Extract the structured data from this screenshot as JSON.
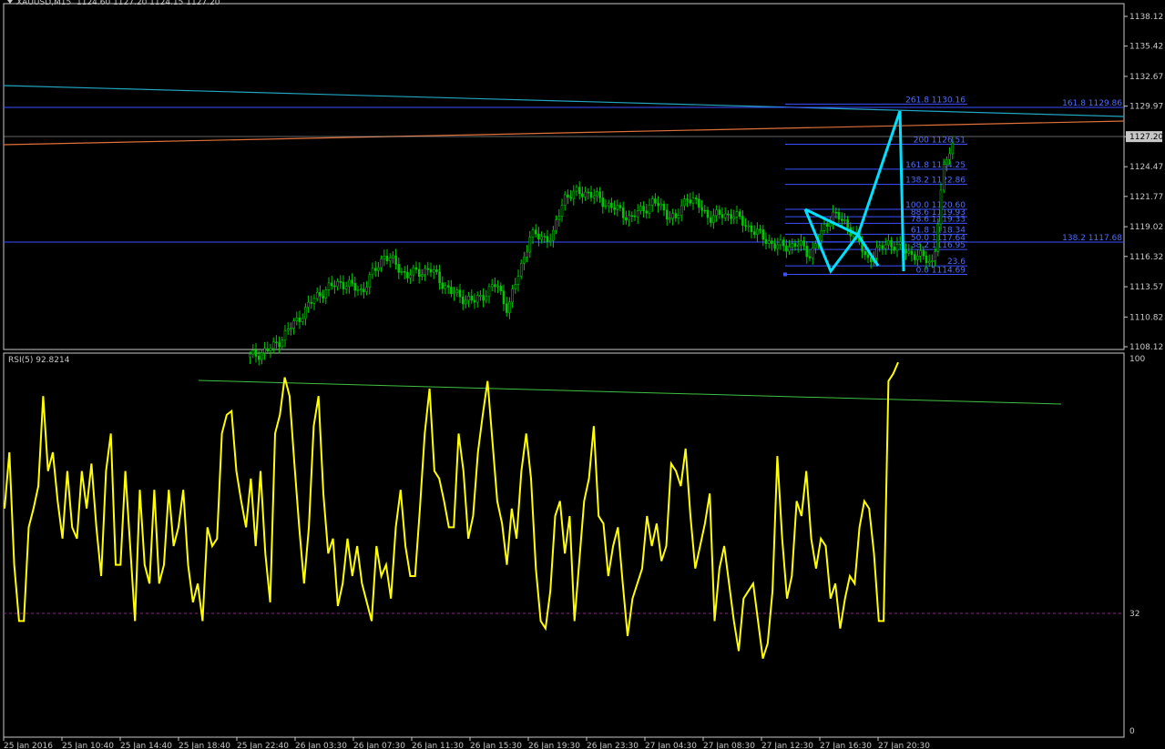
{
  "header": {
    "symbol": "XAUUSD,M15",
    "ohlc": "1124.60 1127.20 1124.15 1127.20",
    "rsi_label": "RSI(5) 92.8214"
  },
  "colors": {
    "background": "#000000",
    "candle_up": "#00c800",
    "rsi_line": "#ffff00",
    "fib_line": "#3c50ff",
    "fib_text": "#4f6cff",
    "zigzag": "#00e0ff",
    "trend_cyan": "#22a4c2",
    "trend_orange": "#e0703a",
    "trend_green": "#40c040",
    "axis": "#c8c8c8",
    "rsi_level": "#7a2a7a"
  },
  "chart_data": [
    {
      "type": "candlestick",
      "symbol": "XAUUSD",
      "timeframe": "M15",
      "ylim": [
        1108.12,
        1138.12
      ],
      "price_ticks": [
        "1138.12",
        "1135.42",
        "1132.67",
        "1129.97",
        "1127.20",
        "1124.47",
        "1121.77",
        "1119.02",
        "1116.32",
        "1113.57",
        "1110.82",
        "1108.12"
      ],
      "current_price": "1127.20",
      "time_ticks": [
        "25 Jan 2016",
        "25 Jan 10:40",
        "25 Jan 14:40",
        "25 Jan 18:40",
        "25 Jan 22:40",
        "26 Jan 03:30",
        "26 Jan 07:30",
        "26 Jan 11:30",
        "26 Jan 15:30",
        "26 Jan 19:30",
        "26 Jan 23:30",
        "27 Jan 04:30",
        "27 Jan 08:30",
        "27 Jan 12:30",
        "27 Jan 16:30",
        "27 Jan 20:30"
      ],
      "close_path": [
        [
          0.22,
          1107.2
        ],
        [
          0.24,
          1108.0
        ],
        [
          0.26,
          1110.3
        ],
        [
          0.28,
          1112.8
        ],
        [
          0.3,
          1114.0
        ],
        [
          0.32,
          1113.2
        ],
        [
          0.34,
          1116.5
        ],
        [
          0.36,
          1114.6
        ],
        [
          0.38,
          1115.2
        ],
        [
          0.4,
          1113.0
        ],
        [
          0.42,
          1112.2
        ],
        [
          0.44,
          1113.8
        ],
        [
          0.45,
          1111.5
        ],
        [
          0.47,
          1118.2
        ],
        [
          0.49,
          1118.0
        ],
        [
          0.5,
          1121.8
        ],
        [
          0.52,
          1122.2
        ],
        [
          0.54,
          1121.0
        ],
        [
          0.56,
          1119.8
        ],
        [
          0.58,
          1121.3
        ],
        [
          0.6,
          1119.6
        ],
        [
          0.61,
          1121.9
        ],
        [
          0.63,
          1119.9
        ],
        [
          0.65,
          1120.2
        ],
        [
          0.67,
          1118.6
        ],
        [
          0.69,
          1117.2
        ],
        [
          0.71,
          1117.4
        ],
        [
          0.72,
          1116.5
        ],
        [
          0.74,
          1120.3
        ],
        [
          0.76,
          1118.4
        ],
        [
          0.77,
          1116.0
        ],
        [
          0.79,
          1117.6
        ],
        [
          0.81,
          1116.6
        ],
        [
          0.83,
          1115.8
        ],
        [
          0.84,
          1125.0
        ],
        [
          0.85,
          1127.2
        ]
      ],
      "fib_upper": [
        {
          "level": "261.8",
          "price": "1130.16"
        },
        {
          "level": "200",
          "price": "1126.51"
        },
        {
          "level": "161.8",
          "price": "1124.25"
        },
        {
          "level": "138.2",
          "price": "1122.86"
        },
        {
          "level": "100.0",
          "price": "1120.60"
        },
        {
          "level": "88.6",
          "price": "1119.93"
        },
        {
          "level": "78.6",
          "price": "1119.33"
        },
        {
          "level": "61.8",
          "price": "1118.34"
        },
        {
          "level": "50.0",
          "price": "1117.64"
        },
        {
          "level": "38.2",
          "price": "1116.95"
        },
        {
          "level": "23.6",
          "price": ""
        },
        {
          "level": "0.0",
          "price": "1114.69"
        }
      ],
      "fib_extra": [
        {
          "level": "161.8",
          "price": "1129.86"
        },
        {
          "level": "138.2",
          "price": "1117.68"
        }
      ]
    },
    {
      "type": "line",
      "indicator": "RSI(5)",
      "last_value": 92.8214,
      "ylim": [
        0,
        100
      ],
      "axis_labels": [
        "100",
        "32",
        "0"
      ],
      "level": 32,
      "values": [
        60,
        75,
        45,
        30,
        30,
        55,
        60,
        66,
        90,
        70,
        75,
        62,
        52,
        70,
        55,
        52,
        70,
        60,
        72,
        55,
        42,
        70,
        80,
        45,
        45,
        70,
        50,
        30,
        65,
        45,
        40,
        65,
        40,
        45,
        65,
        50,
        55,
        65,
        45,
        35,
        40,
        30,
        55,
        50,
        52,
        80,
        85,
        86,
        70,
        62,
        55,
        68,
        50,
        70,
        48,
        35,
        80,
        85,
        95,
        90,
        72,
        55,
        40,
        55,
        82,
        90,
        64,
        48,
        52,
        34,
        40,
        52,
        42,
        50,
        40,
        35,
        30,
        50,
        42,
        45,
        36,
        55,
        65,
        50,
        42,
        42,
        60,
        80,
        92,
        70,
        68,
        62,
        55,
        55,
        80,
        70,
        52,
        58,
        75,
        85,
        94,
        78,
        62,
        56,
        45,
        60,
        52,
        70,
        80,
        68,
        44,
        30,
        28,
        38,
        58,
        62,
        48,
        58,
        30,
        46,
        62,
        68,
        82,
        58,
        56,
        42,
        50,
        55,
        40,
        26,
        36,
        40,
        44,
        58,
        50,
        56,
        46,
        50,
        72,
        70,
        66,
        76,
        58,
        44,
        50,
        56,
        64,
        30,
        44,
        50,
        40,
        30,
        22,
        36,
        38,
        40,
        30,
        20,
        24,
        38,
        74,
        52,
        36,
        42,
        62,
        58,
        70,
        52,
        44,
        52,
        50,
        36,
        40,
        28,
        36,
        42,
        40,
        55,
        62,
        60,
        48,
        30,
        30,
        94,
        96,
        99
      ]
    }
  ]
}
